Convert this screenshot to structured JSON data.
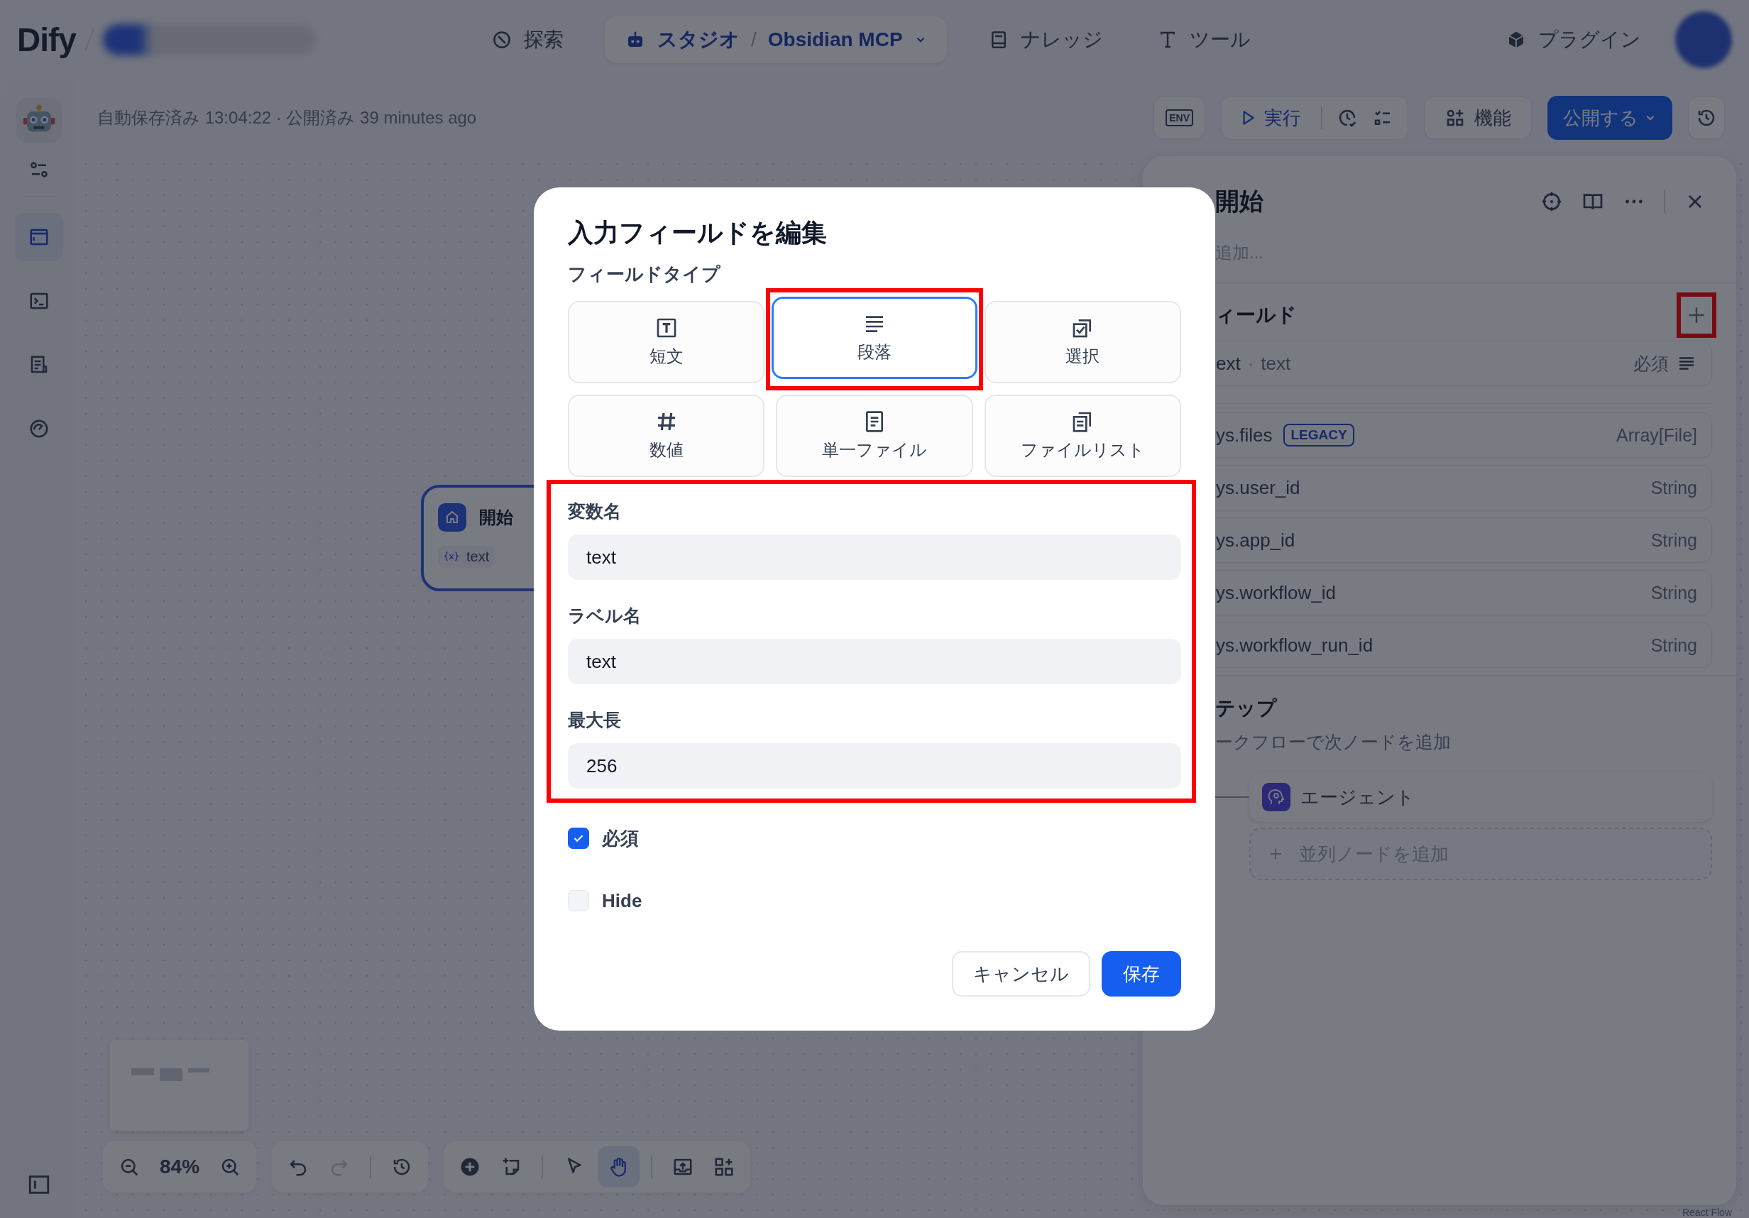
{
  "header": {
    "logo": "Dify",
    "nav": [
      {
        "kind": "explore",
        "label": "探索",
        "selected": false
      },
      {
        "kind": "studio",
        "label": "スタジオ",
        "separator": "/",
        "app_name": "Obsidian MCP",
        "selected": true
      },
      {
        "kind": "knowledge",
        "label": "ナレッジ",
        "selected": false
      },
      {
        "kind": "tools",
        "label": "ツール",
        "selected": false
      }
    ],
    "plugins": "プラグイン"
  },
  "sidebar": {
    "items": [
      {
        "kind": "orchestrate",
        "selected": true
      },
      {
        "kind": "api",
        "selected": false
      },
      {
        "kind": "logs",
        "selected": false
      },
      {
        "kind": "monitoring",
        "selected": false
      }
    ]
  },
  "toolbar": {
    "status": "自動保存済み 13:04:22 · 公開済み 39 minutes ago",
    "env": "ENV",
    "run": "実行",
    "features": "機能",
    "publish": "公開する"
  },
  "canvas": {
    "node": {
      "title": "開始",
      "variable": "text"
    },
    "zoom": "84%",
    "history": [
      {
        "kind": "undo",
        "disabled": false
      },
      {
        "kind": "redo",
        "disabled": true
      }
    ],
    "tools": [
      {
        "kind": "pointer",
        "selected": false
      },
      {
        "kind": "hand",
        "selected": true
      }
    ],
    "attribution": "React Flow"
  },
  "panel": {
    "title": "開始",
    "description_placeholder": "追加...",
    "fields_heading": "ィールド",
    "add_highlighted": true,
    "inputs": [
      {
        "name": "ext",
        "separator": "·",
        "label": "text",
        "required": "必須"
      }
    ],
    "system_vars": [
      {
        "name": "ys.files",
        "badge": "LEGACY",
        "type": "Array[File]"
      },
      {
        "name": "ys.user_id",
        "type": "String"
      },
      {
        "name": "ys.app_id",
        "type": "String"
      },
      {
        "name": "ys.workflow_id",
        "type": "String"
      },
      {
        "name": "ys.workflow_run_id",
        "type": "String"
      }
    ],
    "next_step": {
      "heading": "テップ",
      "description": "ークフローで次ノードを追加",
      "nodes": [
        {
          "label": "エージェント"
        }
      ],
      "add_parallel": "並列ノードを追加"
    }
  },
  "dialog": {
    "title": "入力フィールドを編集",
    "type_heading": "フィールドタイプ",
    "types": [
      {
        "kind": "text-input",
        "label": "短文",
        "selected": false,
        "highlighted": false
      },
      {
        "kind": "paragraph",
        "label": "段落",
        "selected": true,
        "highlighted": true
      },
      {
        "kind": "select",
        "label": "選択",
        "selected": false,
        "highlighted": false
      },
      {
        "kind": "number",
        "label": "数値",
        "selected": false,
        "highlighted": false
      },
      {
        "kind": "single-file",
        "label": "単一ファイル",
        "selected": false,
        "highlighted": false
      },
      {
        "kind": "file-list",
        "label": "ファイルリスト",
        "selected": false,
        "highlighted": false
      }
    ],
    "fields_highlighted": true,
    "fields": [
      {
        "label": "変数名",
        "value": "text"
      },
      {
        "label": "ラベル名",
        "value": "text"
      },
      {
        "label": "最大長",
        "value": "256"
      }
    ],
    "options": [
      {
        "label": "必須",
        "checked": true
      },
      {
        "label": "Hide",
        "checked": false
      }
    ],
    "buttons": [
      {
        "kind": "cancel",
        "label": "キャンセル"
      },
      {
        "kind": "save",
        "label": "保存"
      }
    ]
  }
}
